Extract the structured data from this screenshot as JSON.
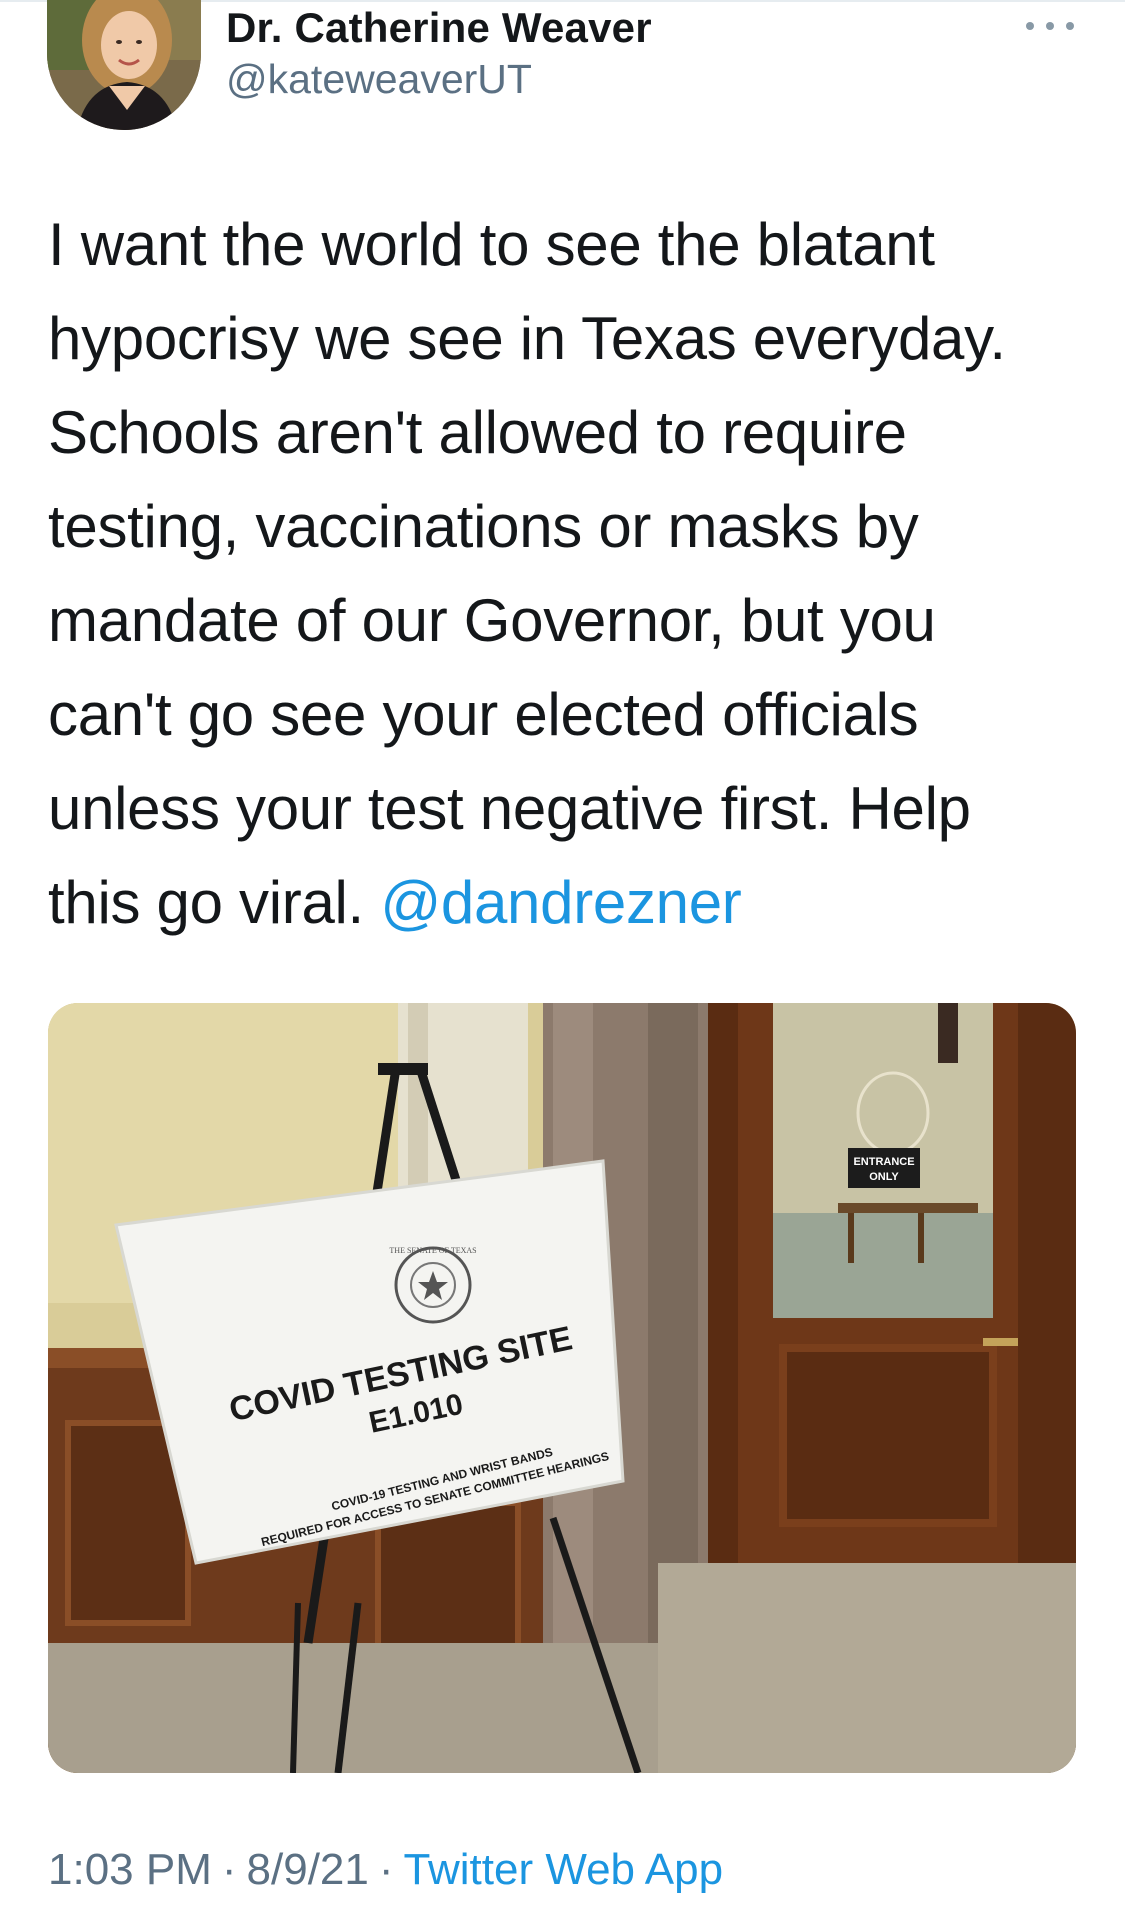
{
  "author": {
    "display_name": "Dr. Catherine Weaver",
    "handle": "@kateweaverUT"
  },
  "tweet": {
    "lines": [
      "I want the world to see the blatant",
      "hypocrisy we see in Texas everyday.",
      "Schools aren't allowed to require",
      "testing, vaccinations or masks by",
      "mandate of our Governor, but you",
      "can't go see your elected officials",
      "unless your test negative first. Help",
      "this go viral."
    ],
    "mention": "@dandrezner"
  },
  "photo": {
    "sign_seal": "THE SENATE OF TEXAS",
    "sign_title": "COVID TESTING SITE",
    "sign_room": "E1.010",
    "sign_line1": "COVID-19 TESTING AND WRIST BANDS",
    "sign_line2": "REQUIRED FOR ACCESS TO SENATE COMMITTEE HEARINGS",
    "door_sign_line1": "ENTRANCE",
    "door_sign_line2": "ONLY"
  },
  "footer": {
    "time": "1:03 PM",
    "date": "8/9/21",
    "source": "Twitter Web App",
    "separator": "·"
  },
  "colors": {
    "link": "#1b95e0",
    "secondary_text": "#5b7083",
    "primary_text": "#14171a"
  },
  "icons": {
    "more": "more-horizontal-icon"
  }
}
